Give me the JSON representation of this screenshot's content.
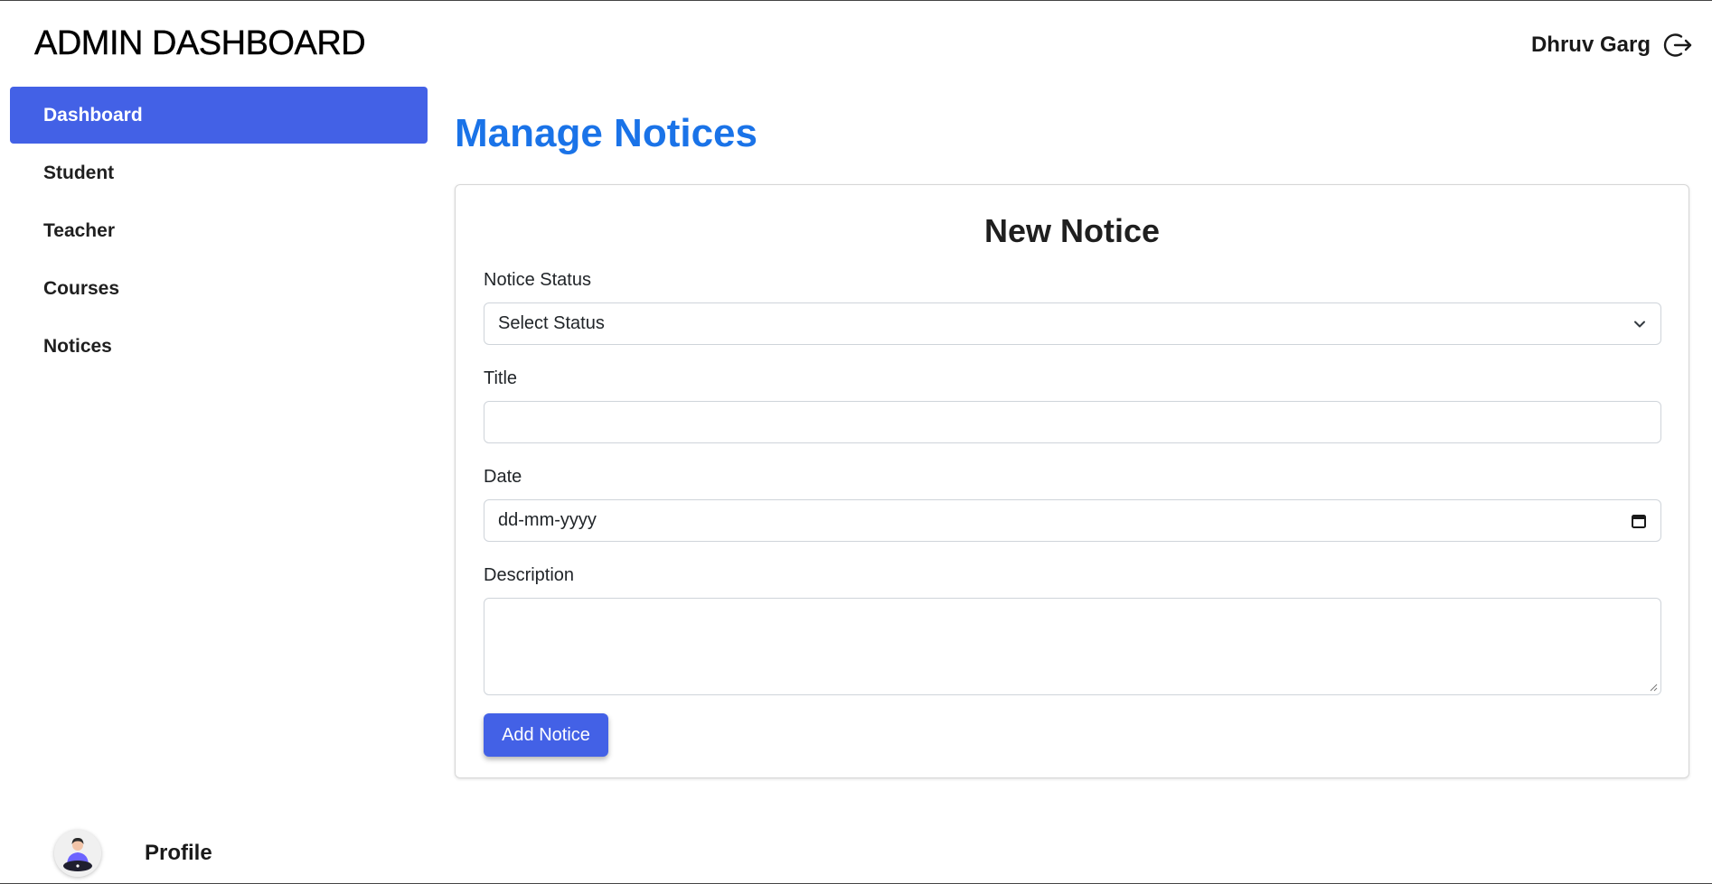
{
  "header": {
    "brand": "ADMIN DASHBOARD",
    "user_name": "Dhruv Garg",
    "logout_icon": "logout-icon"
  },
  "sidebar": {
    "items": [
      {
        "label": "Dashboard",
        "active": true
      },
      {
        "label": "Student",
        "active": false
      },
      {
        "label": "Teacher",
        "active": false
      },
      {
        "label": "Courses",
        "active": false
      },
      {
        "label": "Notices",
        "active": false
      }
    ],
    "profile_label": "Profile",
    "accent_color": "#4361e6"
  },
  "main": {
    "page_title": "Manage Notices",
    "page_title_color": "#1a73e8",
    "form": {
      "title": "New Notice",
      "status_label": "Notice Status",
      "status_value": "Select Status",
      "title_label": "Title",
      "title_value": "",
      "date_label": "Date",
      "date_placeholder": "dd-mm-yyyy",
      "description_label": "Description",
      "description_value": "",
      "submit_label": "Add Notice"
    }
  }
}
